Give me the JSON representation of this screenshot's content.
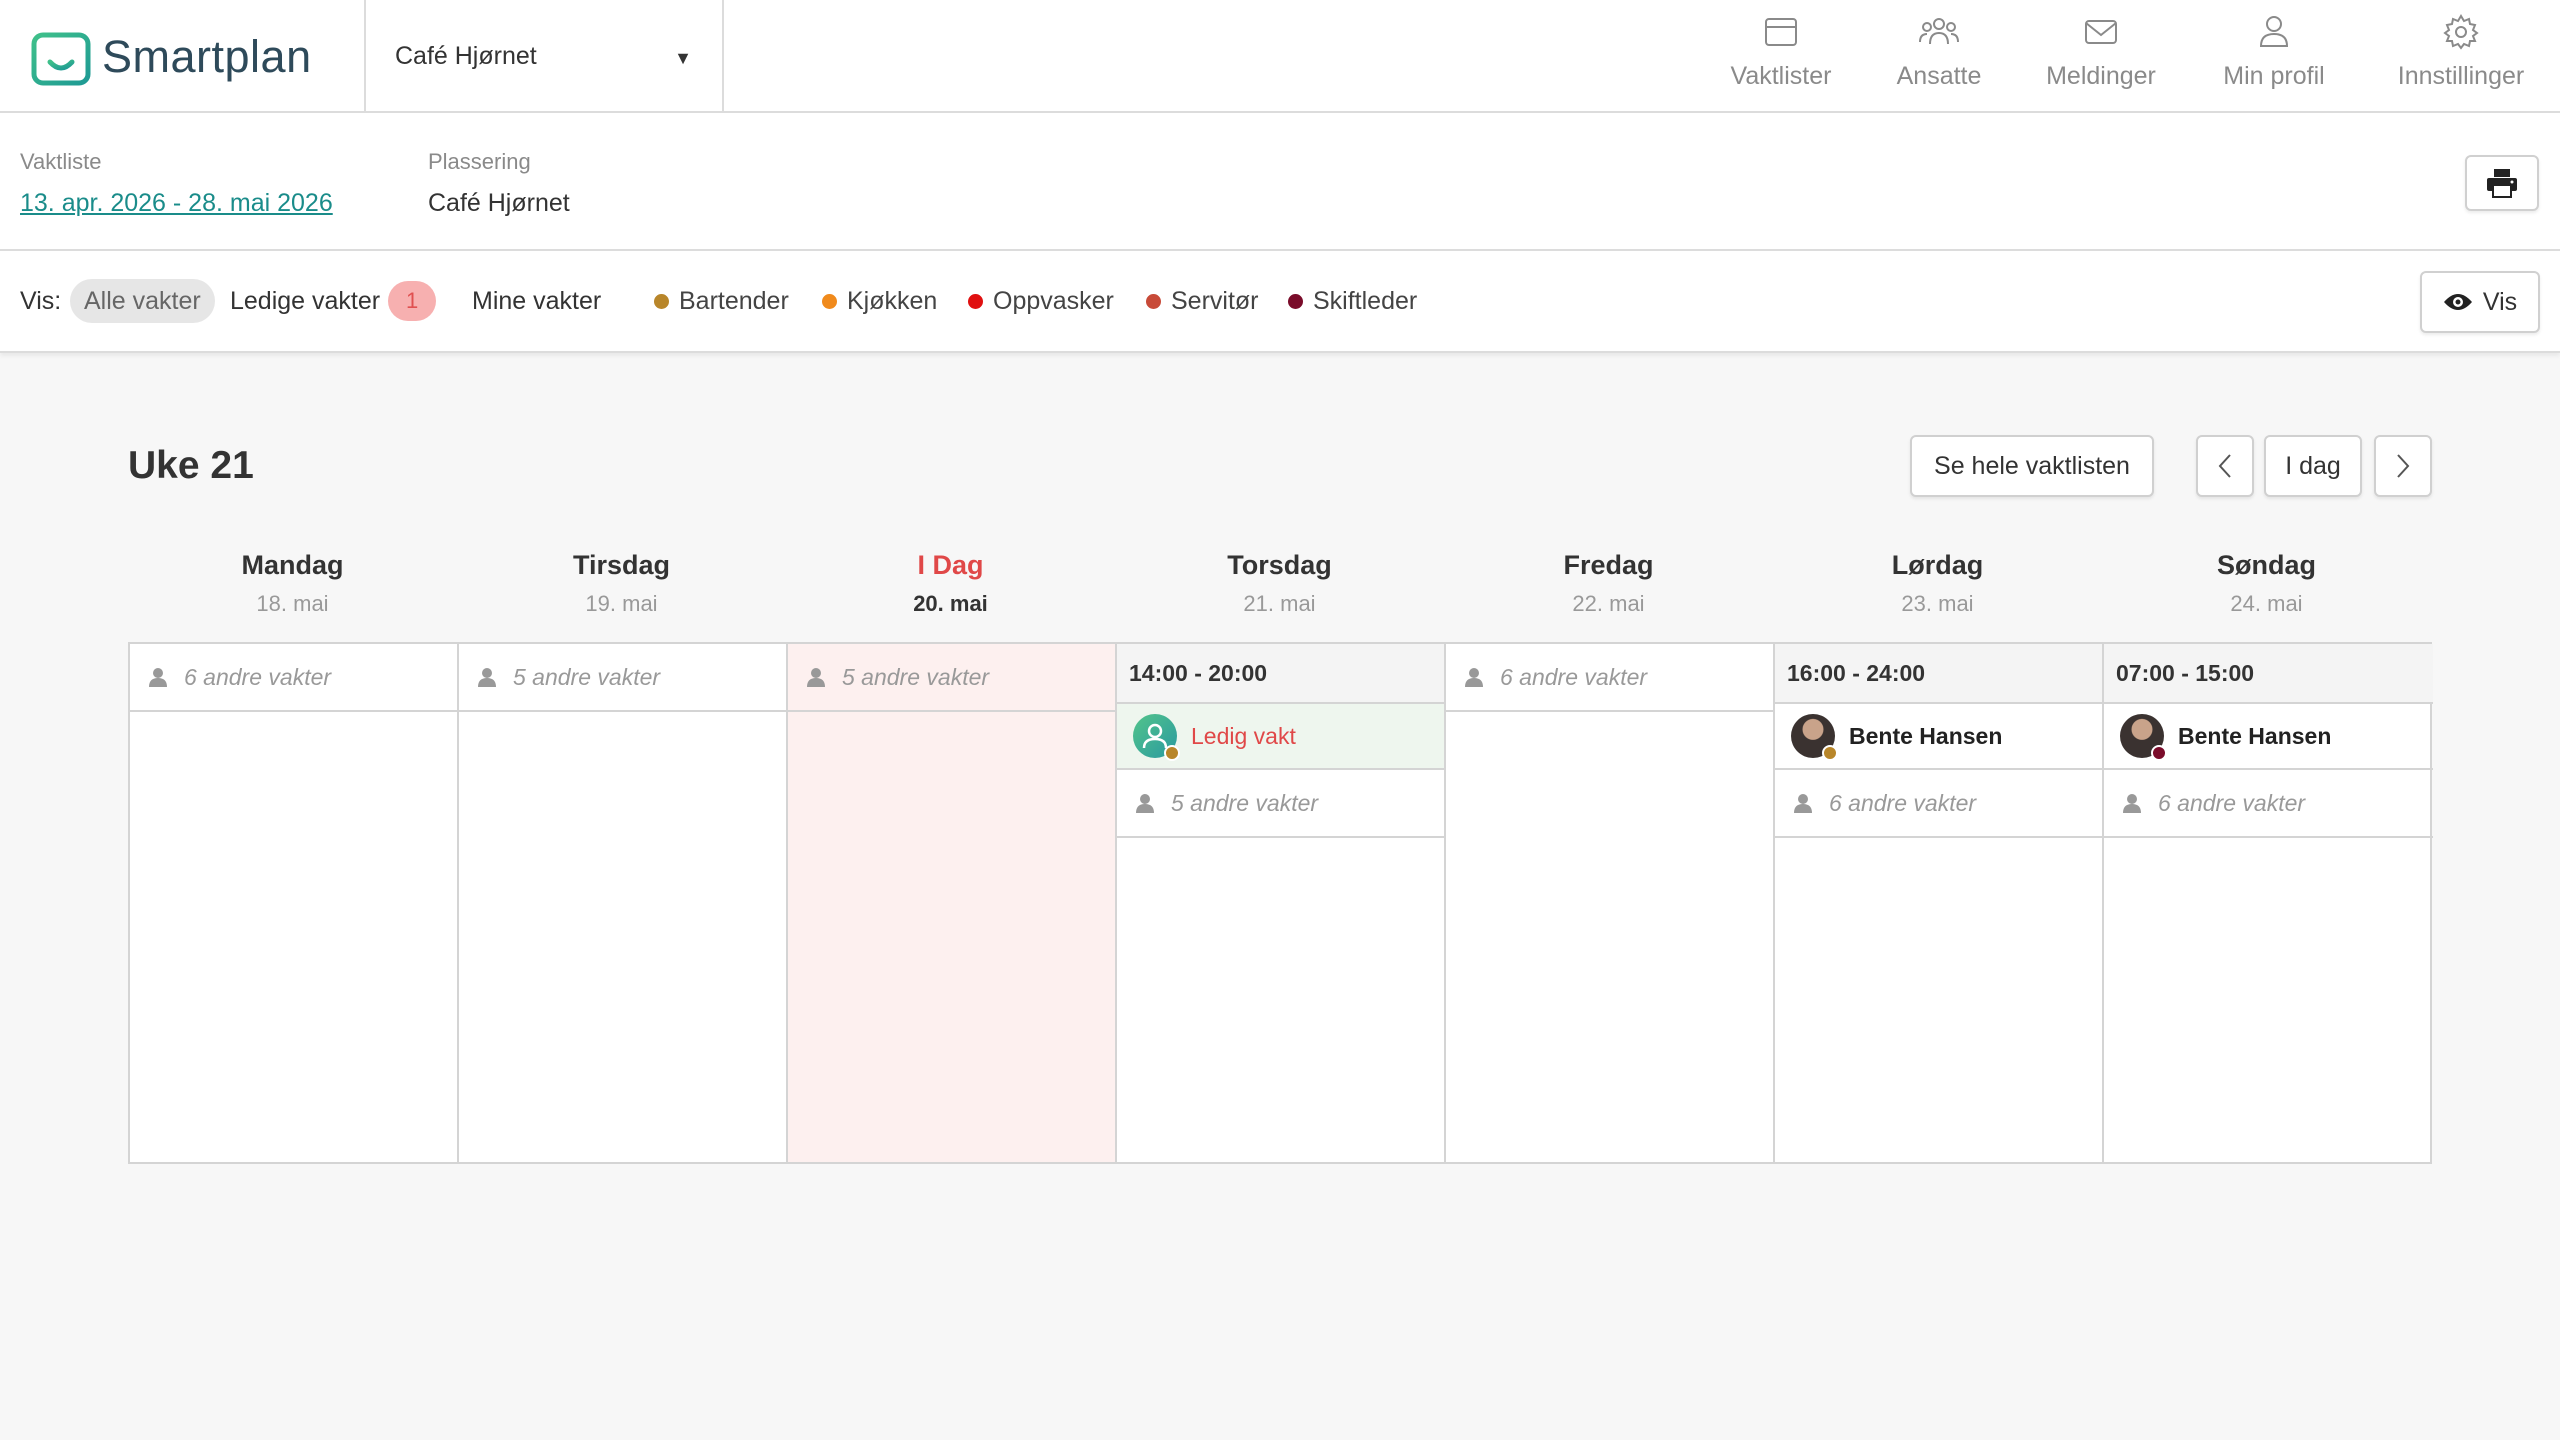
{
  "app": {
    "name": "Smartplan"
  },
  "venue_select": {
    "value": "Café Hjørnet"
  },
  "nav": [
    {
      "id": "vaktlister",
      "label": "Vaktlister",
      "icon": "calendar-icon"
    },
    {
      "id": "ansatte",
      "label": "Ansatte",
      "icon": "users-icon"
    },
    {
      "id": "meldinger",
      "label": "Meldinger",
      "icon": "mail-icon"
    },
    {
      "id": "min-profil",
      "label": "Min profil",
      "icon": "user-icon"
    },
    {
      "id": "innstillinger",
      "label": "Innstillinger",
      "icon": "gear-icon"
    }
  ],
  "info": {
    "roster_label": "Vaktliste",
    "roster_range": "13. apr. 2026 - 28. mai 2026",
    "location_label": "Plassering",
    "location_value": "Café Hjørnet"
  },
  "filters": {
    "prefix": "Vis:",
    "all": "Alle vakter",
    "open": "Ledige vakter",
    "open_count": "1",
    "mine": "Mine vakter",
    "vis_button": "Vis"
  },
  "roles": [
    {
      "name": "Bartender",
      "color": "#b8862a"
    },
    {
      "name": "Kjøkken",
      "color": "#f08a1c"
    },
    {
      "name": "Oppvasker",
      "color": "#e01010"
    },
    {
      "name": "Servitør",
      "color": "#c84a38"
    },
    {
      "name": "Skiftleder",
      "color": "#7a0c2a"
    }
  ],
  "week": {
    "title": "Uke 21",
    "see_all": "Se hele vaktlisten",
    "today_btn": "I dag"
  },
  "days": [
    {
      "name": "Mandag",
      "date": "18. mai",
      "others": "6 andre vakter"
    },
    {
      "name": "Tirsdag",
      "date": "19. mai",
      "others": "5 andre vakter"
    },
    {
      "name": "I Dag",
      "date": "20. mai",
      "others": "5 andre vakter"
    },
    {
      "name": "Torsdag",
      "date": "21. mai",
      "shift_time": "14:00 - 20:00",
      "shift_label": "Ledig vakt",
      "others": "5 andre vakter"
    },
    {
      "name": "Fredag",
      "date": "22. mai",
      "others": "6 andre vakter"
    },
    {
      "name": "Lørdag",
      "date": "23. mai",
      "shift_time": "16:00 - 24:00",
      "shift_label": "Bente Hansen",
      "others": "6 andre vakter"
    },
    {
      "name": "Søndag",
      "date": "24. mai",
      "shift_time": "07:00 - 15:00",
      "shift_label": "Bente Hansen",
      "others": "6 andre vakter"
    }
  ]
}
